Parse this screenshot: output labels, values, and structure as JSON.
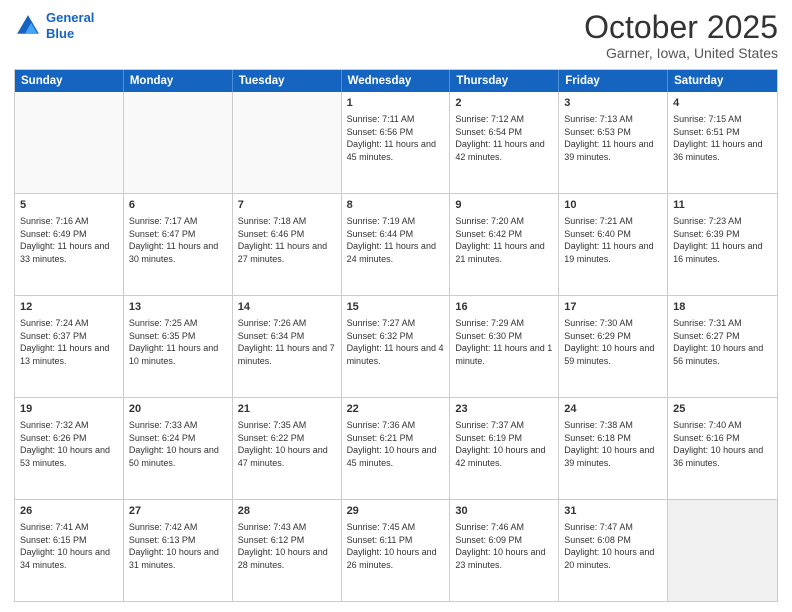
{
  "logo": {
    "line1": "General",
    "line2": "Blue"
  },
  "title": "October 2025",
  "location": "Garner, Iowa, United States",
  "days_of_week": [
    "Sunday",
    "Monday",
    "Tuesday",
    "Wednesday",
    "Thursday",
    "Friday",
    "Saturday"
  ],
  "weeks": [
    [
      {
        "day": "",
        "info": "",
        "empty": true
      },
      {
        "day": "",
        "info": "",
        "empty": true
      },
      {
        "day": "",
        "info": "",
        "empty": true
      },
      {
        "day": "1",
        "info": "Sunrise: 7:11 AM\nSunset: 6:56 PM\nDaylight: 11 hours and 45 minutes."
      },
      {
        "day": "2",
        "info": "Sunrise: 7:12 AM\nSunset: 6:54 PM\nDaylight: 11 hours and 42 minutes."
      },
      {
        "day": "3",
        "info": "Sunrise: 7:13 AM\nSunset: 6:53 PM\nDaylight: 11 hours and 39 minutes."
      },
      {
        "day": "4",
        "info": "Sunrise: 7:15 AM\nSunset: 6:51 PM\nDaylight: 11 hours and 36 minutes."
      }
    ],
    [
      {
        "day": "5",
        "info": "Sunrise: 7:16 AM\nSunset: 6:49 PM\nDaylight: 11 hours and 33 minutes."
      },
      {
        "day": "6",
        "info": "Sunrise: 7:17 AM\nSunset: 6:47 PM\nDaylight: 11 hours and 30 minutes."
      },
      {
        "day": "7",
        "info": "Sunrise: 7:18 AM\nSunset: 6:46 PM\nDaylight: 11 hours and 27 minutes."
      },
      {
        "day": "8",
        "info": "Sunrise: 7:19 AM\nSunset: 6:44 PM\nDaylight: 11 hours and 24 minutes."
      },
      {
        "day": "9",
        "info": "Sunrise: 7:20 AM\nSunset: 6:42 PM\nDaylight: 11 hours and 21 minutes."
      },
      {
        "day": "10",
        "info": "Sunrise: 7:21 AM\nSunset: 6:40 PM\nDaylight: 11 hours and 19 minutes."
      },
      {
        "day": "11",
        "info": "Sunrise: 7:23 AM\nSunset: 6:39 PM\nDaylight: 11 hours and 16 minutes."
      }
    ],
    [
      {
        "day": "12",
        "info": "Sunrise: 7:24 AM\nSunset: 6:37 PM\nDaylight: 11 hours and 13 minutes."
      },
      {
        "day": "13",
        "info": "Sunrise: 7:25 AM\nSunset: 6:35 PM\nDaylight: 11 hours and 10 minutes."
      },
      {
        "day": "14",
        "info": "Sunrise: 7:26 AM\nSunset: 6:34 PM\nDaylight: 11 hours and 7 minutes."
      },
      {
        "day": "15",
        "info": "Sunrise: 7:27 AM\nSunset: 6:32 PM\nDaylight: 11 hours and 4 minutes."
      },
      {
        "day": "16",
        "info": "Sunrise: 7:29 AM\nSunset: 6:30 PM\nDaylight: 11 hours and 1 minute."
      },
      {
        "day": "17",
        "info": "Sunrise: 7:30 AM\nSunset: 6:29 PM\nDaylight: 10 hours and 59 minutes."
      },
      {
        "day": "18",
        "info": "Sunrise: 7:31 AM\nSunset: 6:27 PM\nDaylight: 10 hours and 56 minutes."
      }
    ],
    [
      {
        "day": "19",
        "info": "Sunrise: 7:32 AM\nSunset: 6:26 PM\nDaylight: 10 hours and 53 minutes."
      },
      {
        "day": "20",
        "info": "Sunrise: 7:33 AM\nSunset: 6:24 PM\nDaylight: 10 hours and 50 minutes."
      },
      {
        "day": "21",
        "info": "Sunrise: 7:35 AM\nSunset: 6:22 PM\nDaylight: 10 hours and 47 minutes."
      },
      {
        "day": "22",
        "info": "Sunrise: 7:36 AM\nSunset: 6:21 PM\nDaylight: 10 hours and 45 minutes."
      },
      {
        "day": "23",
        "info": "Sunrise: 7:37 AM\nSunset: 6:19 PM\nDaylight: 10 hours and 42 minutes."
      },
      {
        "day": "24",
        "info": "Sunrise: 7:38 AM\nSunset: 6:18 PM\nDaylight: 10 hours and 39 minutes."
      },
      {
        "day": "25",
        "info": "Sunrise: 7:40 AM\nSunset: 6:16 PM\nDaylight: 10 hours and 36 minutes."
      }
    ],
    [
      {
        "day": "26",
        "info": "Sunrise: 7:41 AM\nSunset: 6:15 PM\nDaylight: 10 hours and 34 minutes."
      },
      {
        "day": "27",
        "info": "Sunrise: 7:42 AM\nSunset: 6:13 PM\nDaylight: 10 hours and 31 minutes."
      },
      {
        "day": "28",
        "info": "Sunrise: 7:43 AM\nSunset: 6:12 PM\nDaylight: 10 hours and 28 minutes."
      },
      {
        "day": "29",
        "info": "Sunrise: 7:45 AM\nSunset: 6:11 PM\nDaylight: 10 hours and 26 minutes."
      },
      {
        "day": "30",
        "info": "Sunrise: 7:46 AM\nSunset: 6:09 PM\nDaylight: 10 hours and 23 minutes."
      },
      {
        "day": "31",
        "info": "Sunrise: 7:47 AM\nSunset: 6:08 PM\nDaylight: 10 hours and 20 minutes."
      },
      {
        "day": "",
        "info": "",
        "empty": true
      }
    ]
  ]
}
